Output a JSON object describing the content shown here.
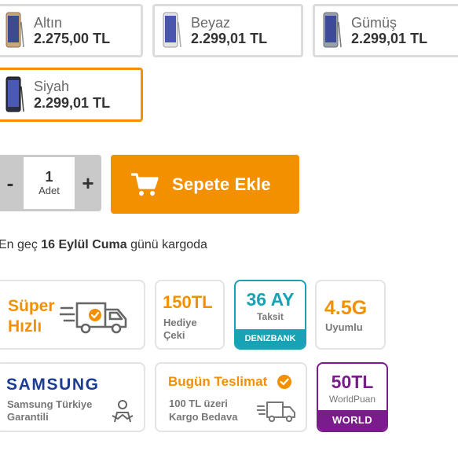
{
  "variants": [
    {
      "name": "Altın",
      "price": "2.275,00 TL",
      "color": "#c9a77a"
    },
    {
      "name": "Beyaz",
      "price": "2.299,01 TL",
      "color": "#d8d8d8"
    },
    {
      "name": "Gümüş",
      "price": "2.299,01 TL",
      "color": "#8f939b"
    },
    {
      "name": "Siyah",
      "price": "2.299,01 TL",
      "color": "#2b2f45",
      "selected": true
    }
  ],
  "quantity": {
    "decrement": "-",
    "value": "1",
    "unit": "Adet",
    "increment": "+"
  },
  "add_to_cart": {
    "label": "Sepete Ekle",
    "icon": "cart-icon"
  },
  "shipping": {
    "prefix": "En geç",
    "date": "16 Eylül Cuma",
    "suffix": "günü kargoda"
  },
  "badges": {
    "super_hizli": {
      "line1": "Süper",
      "line2": "Hızlı",
      "icon": "delivery-truck-icon"
    },
    "hediye": {
      "amount": "150TL",
      "line1": "Hediye",
      "line2": "Çeki"
    },
    "taksit": {
      "amount": "36 AY",
      "label": "Taksit",
      "bank": "DENIZBANK"
    },
    "network": {
      "label": "4.5G",
      "sub": "Uyumlu"
    },
    "samsung": {
      "brand": "SAMSUNG",
      "line1": "Samsung Türkiye",
      "line2": "Garantili",
      "icon": "support-person-icon"
    },
    "bugun": {
      "title": "Bugün Teslimat",
      "line1": "100 TL üzeri",
      "line2": "Kargo Bedava",
      "icon": "truck-icon"
    },
    "worldpuan": {
      "amount": "50TL",
      "label": "WorldPuan",
      "brand": "WORLD"
    }
  },
  "colors": {
    "accent": "#f39000",
    "denizbank": "#18a2b6",
    "world": "#7b1c8c",
    "samsung": "#1a3d93"
  }
}
